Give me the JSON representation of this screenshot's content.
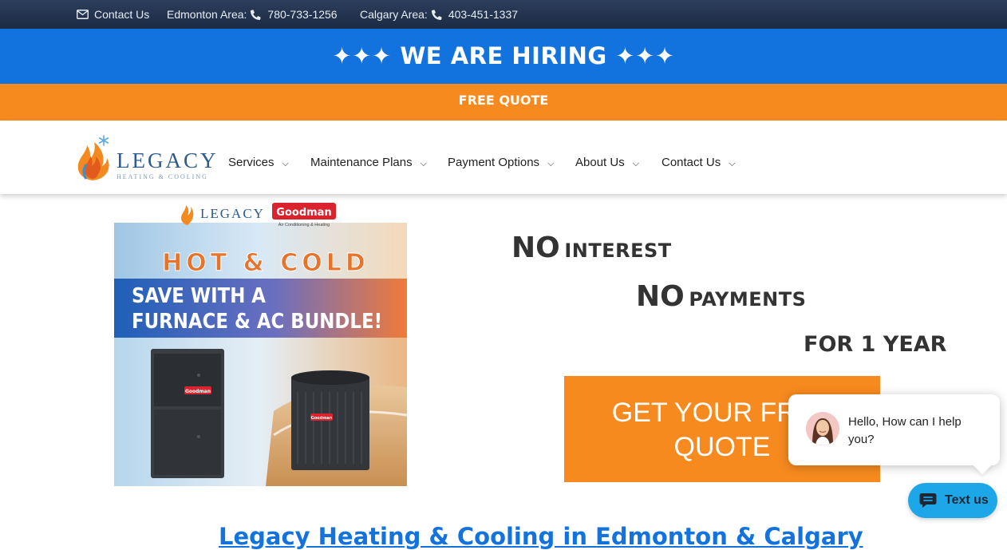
{
  "topbar": {
    "contact_label": "Contact Us",
    "edmonton_label": "Edmonton Area:",
    "edmonton_phone": "780-733-1256",
    "calgary_label": "Calgary Area:",
    "calgary_phone": "403-451-1337"
  },
  "hiring_banner": "✦✦✦ WE ARE HIRING ✦✦✦",
  "free_quote_bar": "FREE QUOTE",
  "logo": {
    "word": "LEGACY",
    "sub": "HEATING & COOLING"
  },
  "nav": [
    {
      "label": "Services"
    },
    {
      "label": "Maintenance Plans"
    },
    {
      "label": "Payment Options"
    },
    {
      "label": "About Us"
    },
    {
      "label": "Contact Us"
    }
  ],
  "promo_image": {
    "brand_left": "LEGACY",
    "brand_right": "Goodman",
    "brand_right_sub": "Air Conditioning & Heating",
    "headline": "HOT & COLD",
    "subhead_1": "SAVE WITH A",
    "subhead_2": "FURNACE & AC BUNDLE!",
    "unit_badge": "Goodman"
  },
  "offer": {
    "line1_big": "NO",
    "line1_small": "INTEREST",
    "line2_big": "NO",
    "line2_small": "PAYMENTS",
    "line3": "FOR 1 YEAR"
  },
  "cta": {
    "line1": "GET YOUR FREE",
    "line2": "QUOTE"
  },
  "section_heading": "Legacy Heating & Cooling in Edmonton & Calgary",
  "chat": {
    "message": "Hello, How can I help you?",
    "button_label": "Text us"
  },
  "colors": {
    "blue": "#1273de",
    "orange": "#f68a1f",
    "navy": "#1c2b44",
    "chat_blue": "#1ea7e8"
  }
}
